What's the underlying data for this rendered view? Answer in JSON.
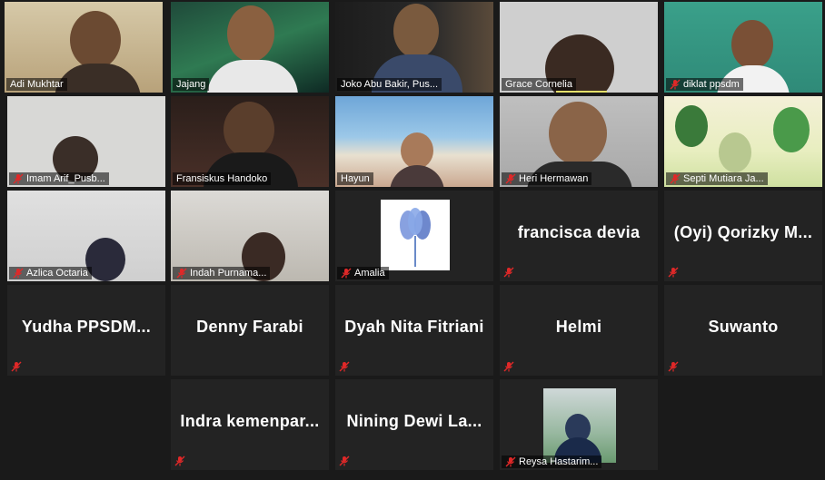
{
  "participants": [
    {
      "name": "Adi Mukhtar",
      "video": true,
      "muted": false,
      "active": true
    },
    {
      "name": "Jajang",
      "video": true,
      "muted": false
    },
    {
      "name": "Joko Abu Bakir, Pus...",
      "video": true,
      "muted": false
    },
    {
      "name": "Grace Cornelia",
      "video": true,
      "muted": false
    },
    {
      "name": "diklat ppsdm",
      "video": true,
      "muted": true
    },
    {
      "name": "Imam Arif_Pusb...",
      "video": true,
      "muted": true
    },
    {
      "name": "Fransiskus Handoko",
      "video": true,
      "muted": false
    },
    {
      "name": "Hayun",
      "video": true,
      "muted": false
    },
    {
      "name": "Heri Hermawan",
      "video": true,
      "muted": true
    },
    {
      "name": "Septi Mutiara Ja...",
      "video": true,
      "muted": true
    },
    {
      "name": "Azlica Octaria",
      "video": true,
      "muted": true
    },
    {
      "name": "Indah Purnama...",
      "video": true,
      "muted": true
    },
    {
      "name": "Amalia",
      "video": true,
      "muted": true
    },
    {
      "name": "francisca devia",
      "video": false,
      "muted": true
    },
    {
      "name": "(Oyi)  Qorizky  M...",
      "video": false,
      "muted": true
    },
    {
      "name": "Yudha  PPSDM...",
      "video": false,
      "muted": true
    },
    {
      "name": "Denny Farabi",
      "video": false,
      "muted": false
    },
    {
      "name": "Dyah Nita Fitriani",
      "video": false,
      "muted": true
    },
    {
      "name": "Helmi",
      "video": false,
      "muted": true
    },
    {
      "name": "Suwanto",
      "video": false,
      "muted": true
    },
    {
      "name": "Indra  kemenpar...",
      "video": false,
      "muted": true
    },
    {
      "name": "Nining  Dewi  La...",
      "video": false,
      "muted": true
    },
    {
      "name": "Reysa Hastarim...",
      "video": true,
      "muted": true
    }
  ],
  "colors": {
    "active_border": "#e5e06a",
    "mute_icon": "#e02828",
    "tile_bg": "#232323"
  }
}
